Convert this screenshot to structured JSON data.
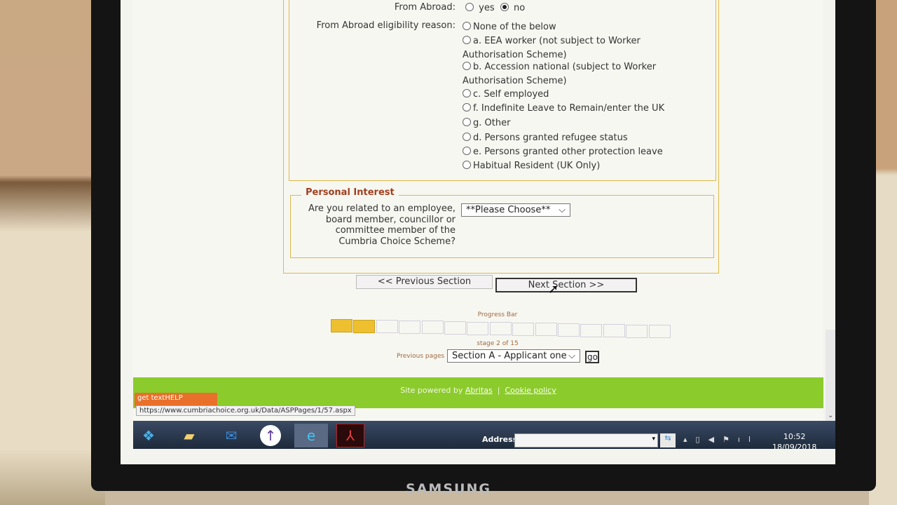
{
  "from_abroad": {
    "label": "From Abroad:",
    "options": [
      {
        "label": "yes",
        "checked": false
      },
      {
        "label": "no",
        "checked": true
      }
    ]
  },
  "eligibility": {
    "label": "From Abroad eligibility reason:",
    "options": [
      "None of the below",
      "a. EEA worker (not subject to Worker Authorisation Scheme)",
      "b. Accession national (subject to Worker Authorisation Scheme)",
      "c. Self employed",
      "f. Indefinite Leave to Remain/enter the UK",
      "g. Other",
      "d. Persons granted refugee status",
      "e. Persons granted other protection leave",
      "Habitual Resident (UK Only)"
    ]
  },
  "personal_interest": {
    "legend": "Personal Interest",
    "question": "Are you related to an employee, board member, councillor or committee member of the Cumbria Choice Scheme?",
    "select_value": "**Please Choose**"
  },
  "nav": {
    "previous": "<< Previous Section",
    "next": "Next Section >>"
  },
  "progress": {
    "label": "Progress Bar",
    "current": 2,
    "total": 15,
    "stage_text": "stage 2 of 15",
    "accent": "#eec030"
  },
  "previous_pages": {
    "label": "Previous pages",
    "value": "Section A - Applicant one",
    "go": "go"
  },
  "footer": {
    "powered_by": "Site powered by",
    "abritas": "Abritas",
    "separator": "|",
    "cookie": "Cookie policy",
    "color": "#8ccb2c"
  },
  "texthelp": {
    "text": "get textHELP"
  },
  "status_url": "https://www.cumbriachoice.org.uk/Data/ASPPages/1/57.aspx",
  "taskbar": {
    "apps": [
      "windows-start-icon",
      "folder-icon",
      "outlook-icon",
      "upload-arrow-icon",
      "internet-explorer-icon",
      "adobe-acrobat-icon"
    ],
    "address_label": "Address",
    "address_value": "",
    "time": "10:52",
    "date": "18/09/2018"
  },
  "monitor_brand": "SAMSUNG"
}
